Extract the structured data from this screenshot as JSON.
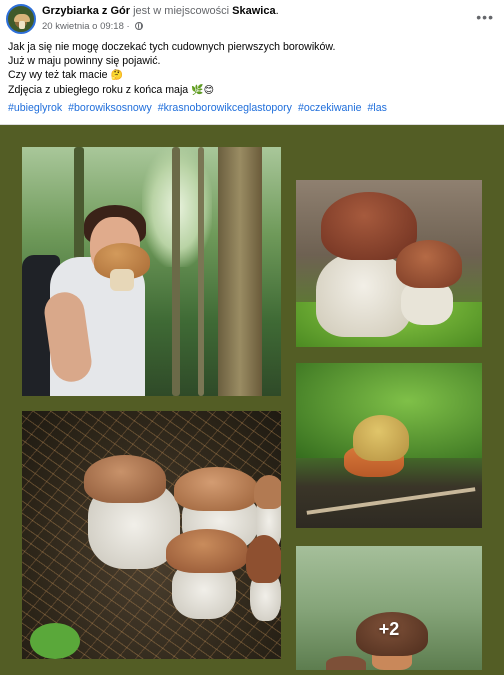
{
  "post": {
    "author": "Grzybiarka z Gór",
    "verb": "jest w miejscowości",
    "location": "Skawica",
    "location_suffix": ".",
    "timestamp": "20 kwietnia o 09:18",
    "separator": "·",
    "privacy_icon": "globe-icon",
    "more_icon": "more-options-icon",
    "text_lines": [
      "Jak ja się nie mogę doczekać tych cudownych pierwszych borowików.",
      "Już w maju powinny się pojawić.",
      "Czy wy też tak macie",
      "Zdjęcia z ubiegłego roku z końca maja"
    ],
    "emoji_1": "🤔",
    "emoji_2": "🌿😊",
    "hashtags": [
      "#ubieglyrok",
      "#borowiksosnowy",
      "#krasnoborowikceglastopory",
      "#oczekiwanie",
      "#las"
    ]
  },
  "gallery": {
    "more_count": "+2",
    "background": "#535d25"
  },
  "colors": {
    "hashtag": "#216fdb",
    "muted": "#65676b"
  }
}
